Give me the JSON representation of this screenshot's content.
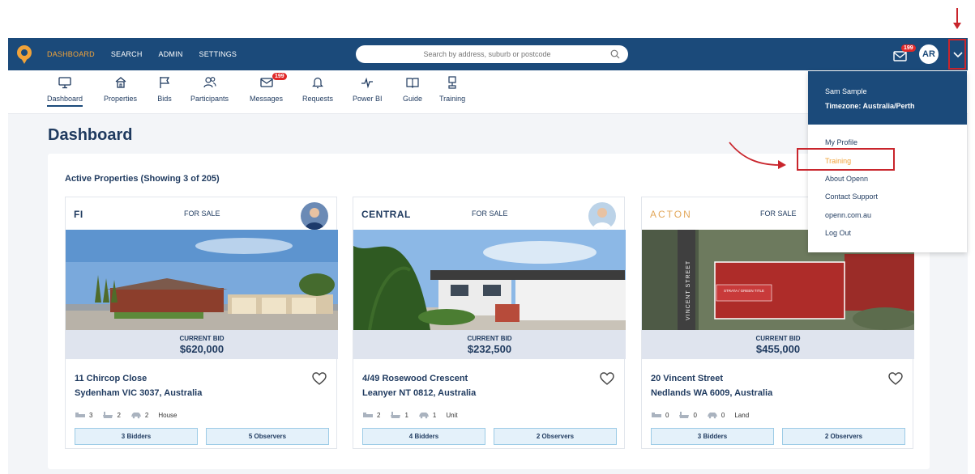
{
  "topbar": {
    "nav": [
      "DASHBOARD",
      "SEARCH",
      "ADMIN",
      "SETTINGS"
    ],
    "search_placeholder": "Search by address, suburb or postcode",
    "mail_badge": "199",
    "avatar": "AR"
  },
  "iconbar": {
    "items": [
      {
        "label": "Dashboard",
        "icon": "monitor-icon"
      },
      {
        "label": "Properties",
        "icon": "home-icon"
      },
      {
        "label": "Bids",
        "icon": "flag-icon"
      },
      {
        "label": "Participants",
        "icon": "users-icon"
      },
      {
        "label": "Messages",
        "icon": "mail-icon",
        "badge": "199"
      },
      {
        "label": "Requests",
        "icon": "bell-icon"
      },
      {
        "label": "Power BI",
        "icon": "pulse-icon"
      },
      {
        "label": "Guide",
        "icon": "book-icon"
      },
      {
        "label": "Training",
        "icon": "trophy-icon"
      }
    ]
  },
  "page": {
    "title": "Dashboard",
    "panel_title": "Active Properties (Showing 3 of 205)"
  },
  "cards": [
    {
      "agency": "FI",
      "status": "FOR SALE",
      "bid_label": "CURRENT BID",
      "bid": "$620,000",
      "address1": "11 Chircop Close",
      "address2": "Sydenham VIC 3037, Australia",
      "beds": "3",
      "baths": "2",
      "cars": "2",
      "type": "House",
      "bidders": "3 Bidders",
      "observers": "5 Observers"
    },
    {
      "agency": "CENTRAL",
      "status": "FOR SALE",
      "bid_label": "CURRENT BID",
      "bid": "$232,500",
      "address1": "4/49 Rosewood Crescent",
      "address2": "Leanyer NT 0812, Australia",
      "beds": "2",
      "baths": "1",
      "cars": "1",
      "type": "Unit",
      "bidders": "4 Bidders",
      "observers": "2 Observers"
    },
    {
      "agency": "ACTON",
      "status": "FOR SALE",
      "bid_label": "CURRENT BID",
      "bid": "$455,000",
      "address1": "20 Vincent Street",
      "address2": "Nedlands WA 6009, Australia",
      "beds": "0",
      "baths": "0",
      "cars": "0",
      "type": "Land",
      "bidders": "3 Bidders",
      "observers": "2 Observers",
      "map_street": "VINCENT STREET",
      "map_tag": "STRATA / GREEN TITLE"
    }
  ],
  "dropdown": {
    "name": "Sam Sample",
    "timezone": "Timezone: Australia/Perth",
    "items": [
      "My Profile",
      "Training",
      "About Openn",
      "Contact Support",
      "openn.com.au",
      "Log Out"
    ]
  },
  "colors": {
    "navy": "#1b4a7a",
    "accent": "#f1a33a",
    "annotation": "#c9252c"
  }
}
